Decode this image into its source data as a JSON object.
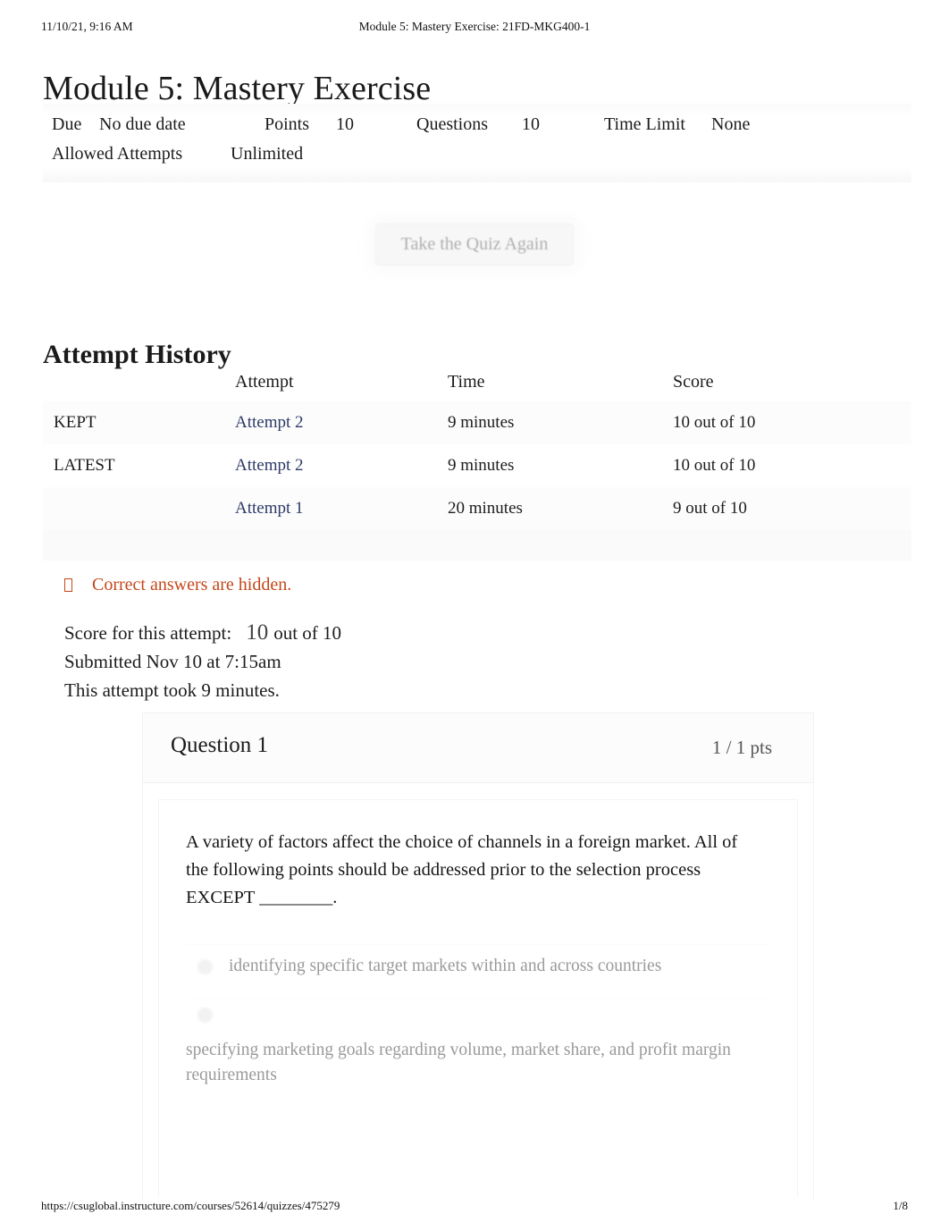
{
  "print_header": {
    "date": "11/10/21, 9:16 AM",
    "doc_title": "Module 5: Mastery Exercise: 21FD-MKG400-1"
  },
  "page_title": "Module 5: Mastery Exercise",
  "quiz_meta": {
    "due_label": "Due",
    "due_value": "No due date",
    "points_label": "Points",
    "points_value": "10",
    "questions_label": "Questions",
    "questions_value": "10",
    "time_limit_label": "Time Limit",
    "time_limit_value": "None",
    "allowed_attempts_label": "Allowed Attempts",
    "allowed_attempts_value": "Unlimited"
  },
  "retake_button": "Take the Quiz Again",
  "attempt_history": {
    "heading": "Attempt History",
    "columns": [
      "",
      "Attempt",
      "Time",
      "Score"
    ],
    "rows": [
      {
        "flag": "KEPT",
        "attempt": "Attempt 2",
        "time": "9 minutes",
        "score": "10 out of 10"
      },
      {
        "flag": "LATEST",
        "attempt": "Attempt 2",
        "time": "9 minutes",
        "score": "10 out of 10"
      },
      {
        "flag": "",
        "attempt": "Attempt 1",
        "time": "20 minutes",
        "score": "9 out of 10"
      }
    ]
  },
  "hidden_answers_note": "Correct answers are hidden.",
  "attempt_summary": {
    "score_label": "Score for this attempt:",
    "score_value": "10",
    "score_suffix": "out of 10",
    "submitted": "Submitted Nov 10 at 7:15am",
    "duration": "This attempt took 9 minutes."
  },
  "question": {
    "name": "Question 1",
    "points": "1 / 1 pts",
    "text": "A variety of factors affect the choice of channels in a foreign market. All of the following points should be addressed prior to the selection process EXCEPT ________.",
    "answers": [
      "identifying specific target markets within and across countries",
      "specifying marketing goals regarding volume, market share, and profit margin requirements"
    ]
  },
  "print_footer": {
    "url": "https://csuglobal.instructure.com/courses/52614/quizzes/475279",
    "page": "1/8"
  },
  "colors": {
    "link": "#2d3a66",
    "notice": "#c4471a",
    "muted": "#9a9a9a"
  }
}
